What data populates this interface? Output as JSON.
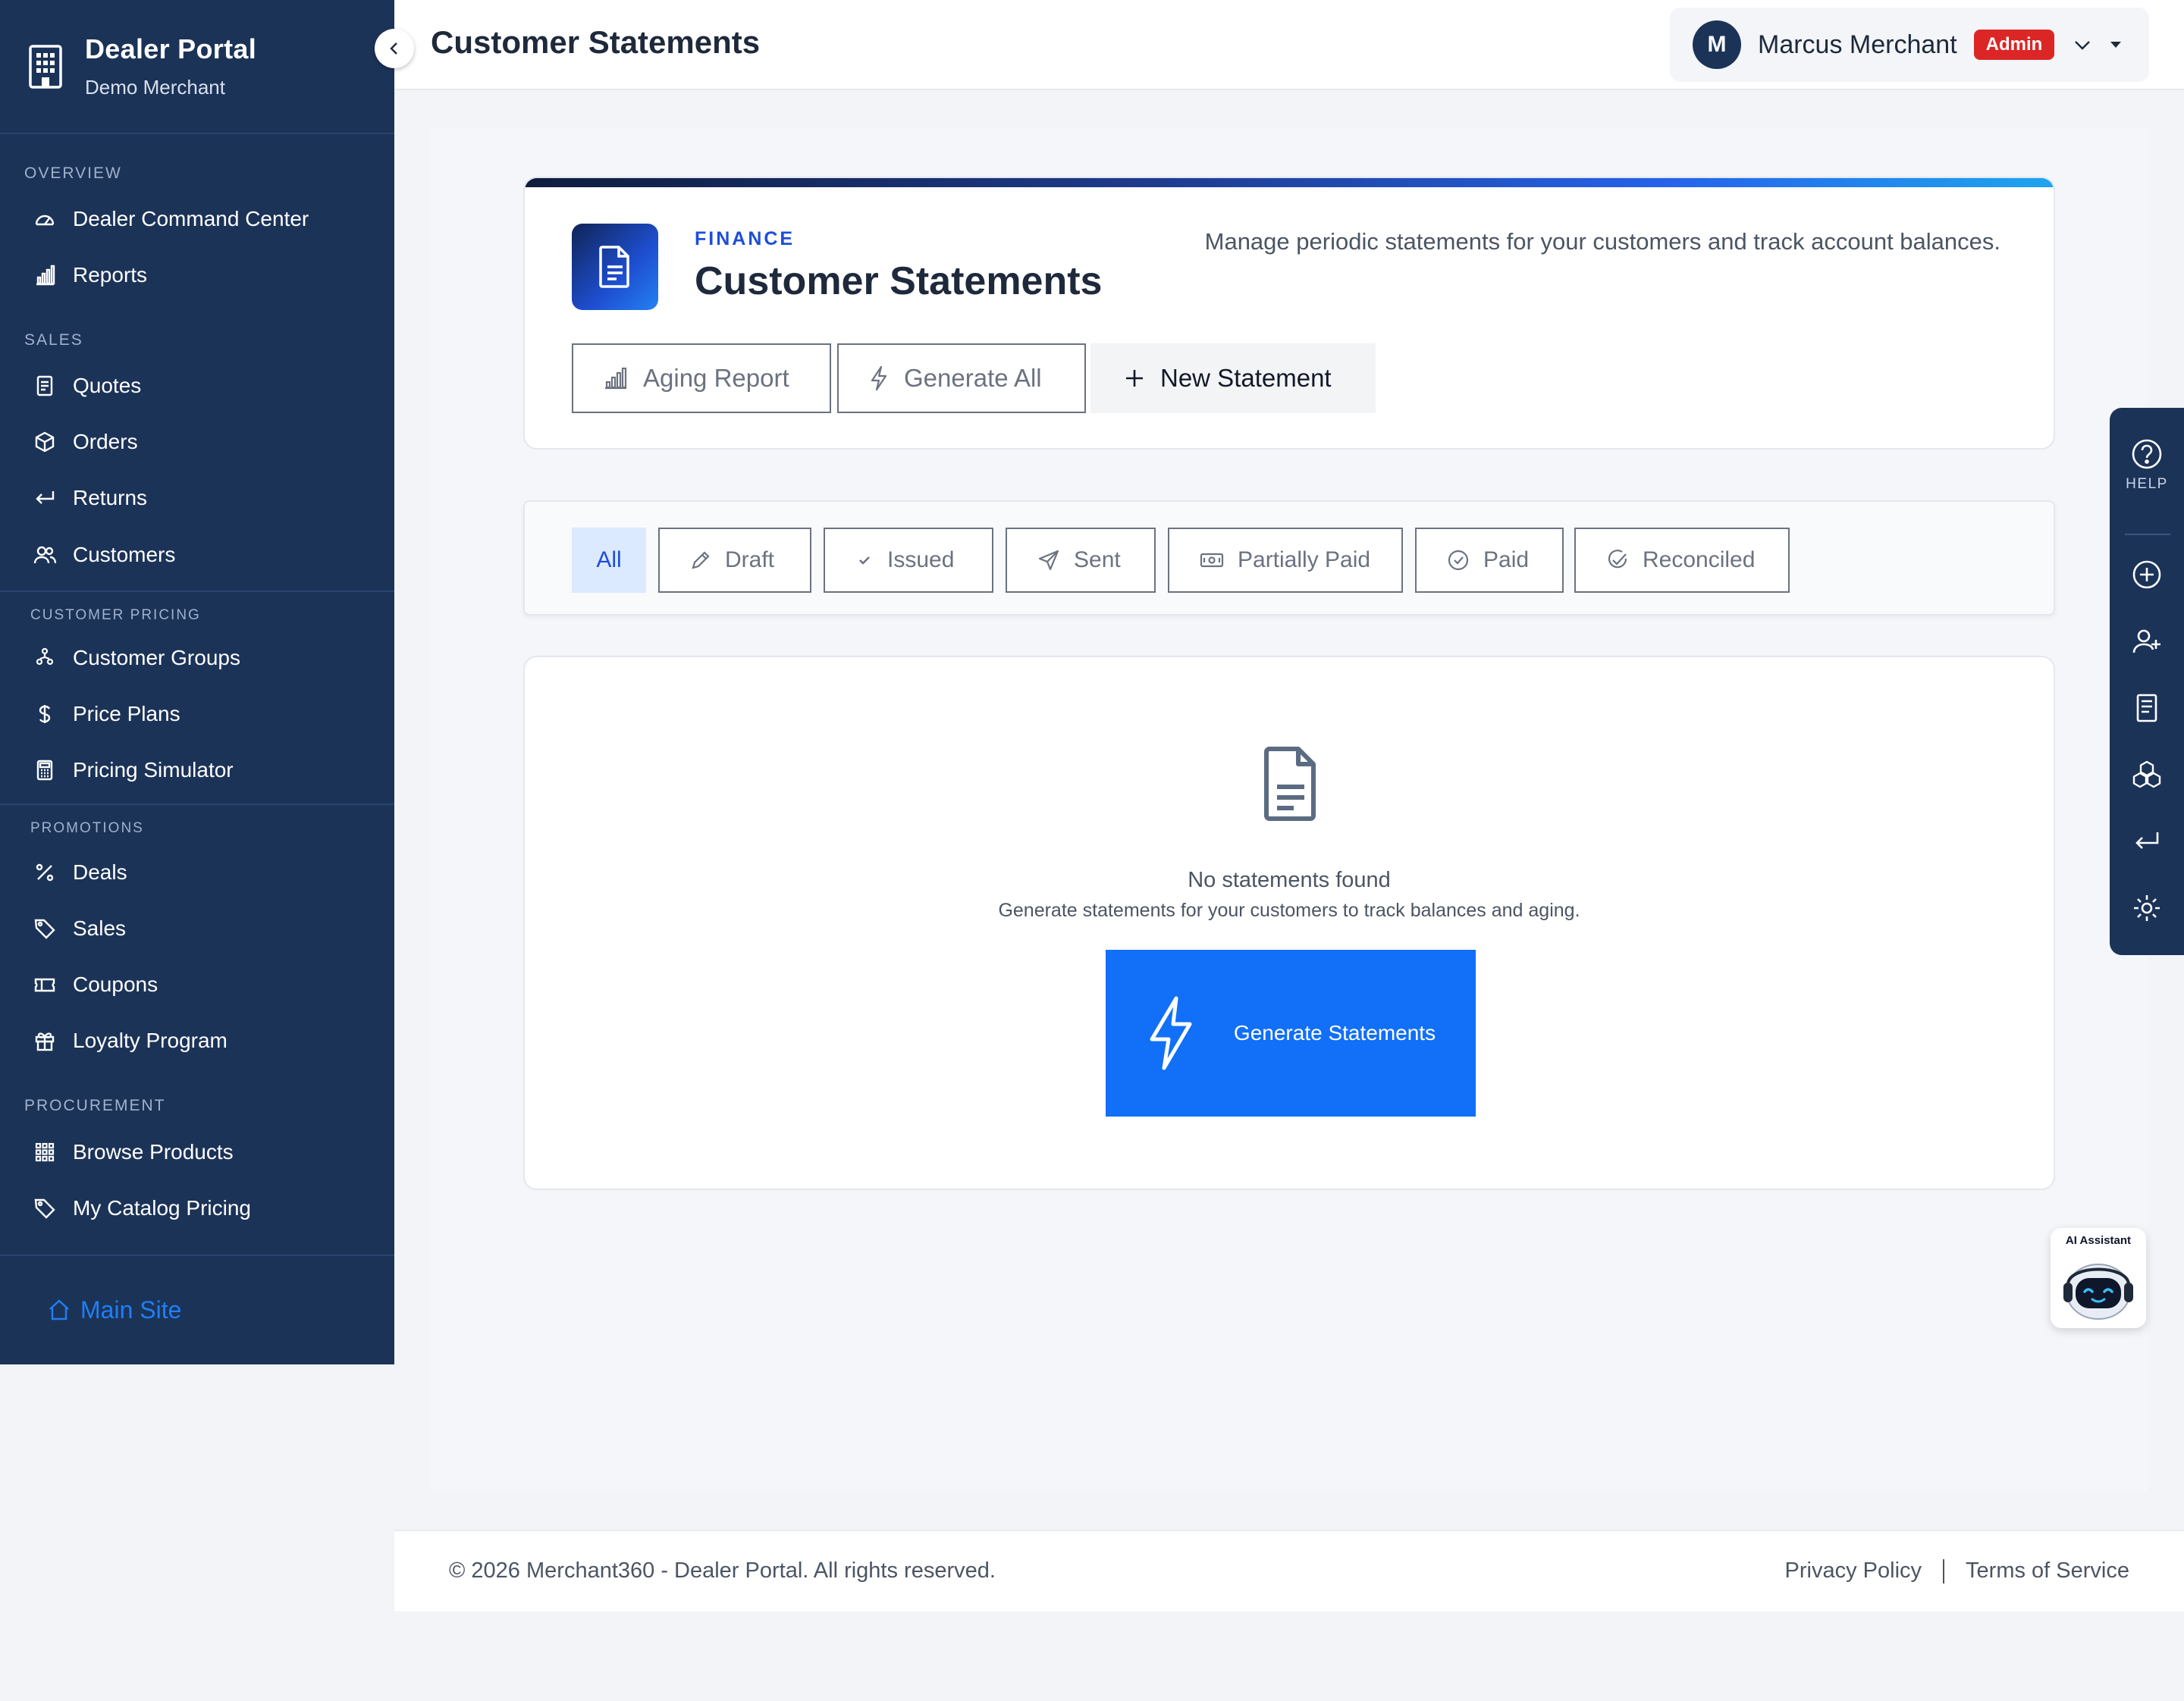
{
  "sidebar": {
    "brand_title": "Dealer Portal",
    "brand_sub": "Demo Merchant",
    "sections": {
      "overview": "OVERVIEW",
      "sales": "SALES",
      "customer_pricing": "CUSTOMER PRICING",
      "promotions": "PROMOTIONS",
      "procurement": "PROCUREMENT"
    },
    "items": {
      "dealer_command_center": "Dealer Command Center",
      "reports": "Reports",
      "quotes": "Quotes",
      "orders": "Orders",
      "returns": "Returns",
      "customers": "Customers",
      "customer_groups": "Customer Groups",
      "price_plans": "Price Plans",
      "pricing_simulator": "Pricing Simulator",
      "deals": "Deals",
      "sales": "Sales",
      "coupons": "Coupons",
      "loyalty_program": "Loyalty Program",
      "browse_products": "Browse Products",
      "my_catalog_pricing": "My Catalog Pricing"
    },
    "main_site": "Main Site"
  },
  "topbar": {
    "title": "Customer Statements",
    "user_initial": "M",
    "user_name": "Marcus Merchant",
    "role_badge": "Admin"
  },
  "header_card": {
    "kicker": "FINANCE",
    "title": "Customer Statements",
    "description": "Manage periodic statements for your customers and track account balances.",
    "buttons": {
      "aging_report": "Aging Report",
      "generate_all": "Generate All",
      "new_statement": "New Statement"
    }
  },
  "filters": {
    "all": "All",
    "draft": "Draft",
    "issued": "Issued",
    "sent": "Sent",
    "partially_paid": "Partially Paid",
    "paid": "Paid",
    "reconciled": "Reconciled",
    "selected": "All"
  },
  "empty_state": {
    "title": "No statements found",
    "subtitle": "Generate statements for your customers to track balances and aging.",
    "button": "Generate Statements"
  },
  "footer": {
    "copyright": "© 2026 Merchant360 - Dealer Portal. All rights reserved.",
    "privacy": "Privacy Policy",
    "terms": "Terms of Service"
  },
  "right_rail": {
    "help_label": "HELP"
  },
  "ai_assistant": {
    "label": "AI Assistant"
  },
  "colors": {
    "sidebar_bg": "#1c3358",
    "primary": "#116ff8",
    "accent_link": "#1f7ff5",
    "badge_red": "#dc2626",
    "kicker_blue": "#1d4ed8"
  },
  "icons": {
    "brand": "building-icon",
    "collapse": "chevron-left-icon",
    "header_badge": "document-icon",
    "empty": "document-icon",
    "generate": "lightning-icon"
  }
}
